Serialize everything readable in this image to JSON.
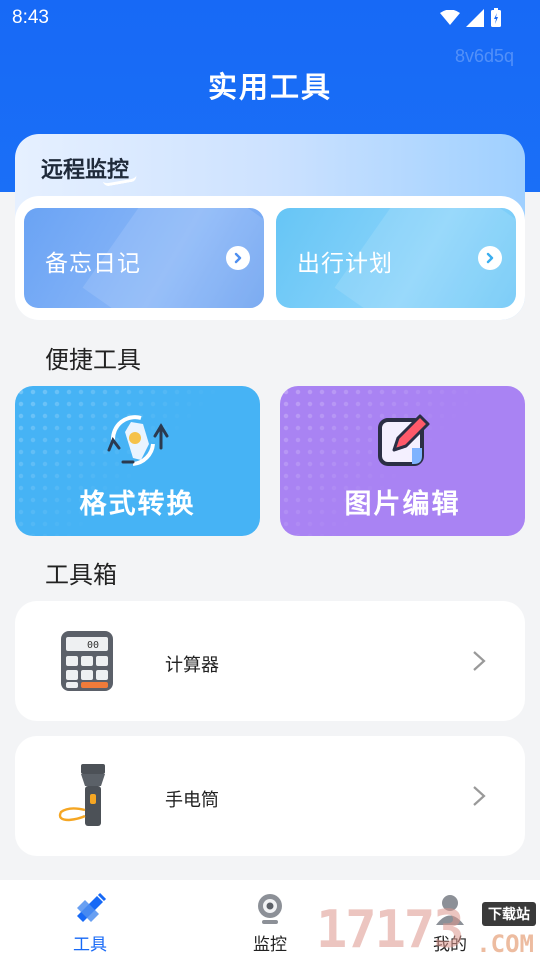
{
  "status": {
    "time": "8:43"
  },
  "watermark_id": "8v6d5q",
  "app_title": "实用工具",
  "monitor": {
    "title": "远程监控",
    "cards": [
      {
        "label": "备忘日记"
      },
      {
        "label": "出行计划"
      }
    ]
  },
  "quick_tools": {
    "title": "便捷工具",
    "items": [
      {
        "label": "格式转换",
        "color": "#46b3f5"
      },
      {
        "label": "图片编辑",
        "color": "#a983f3"
      }
    ]
  },
  "toolbox": {
    "title": "工具箱",
    "items": [
      {
        "label": "计算器",
        "icon": "calculator-icon"
      },
      {
        "label": "手电筒",
        "icon": "flashlight-icon"
      }
    ]
  },
  "bottom_nav": {
    "items": [
      {
        "label": "工具",
        "icon": "ruler-pencil-icon",
        "active": true
      },
      {
        "label": "监控",
        "icon": "webcam-icon",
        "active": false
      },
      {
        "label": "我的",
        "icon": "user-icon",
        "active": false
      }
    ]
  },
  "site_watermark": {
    "number": "17173",
    "badge": "下载站",
    "domain": ".COM"
  },
  "colors": {
    "primary": "#1769f6",
    "background": "#f3f4f6"
  }
}
